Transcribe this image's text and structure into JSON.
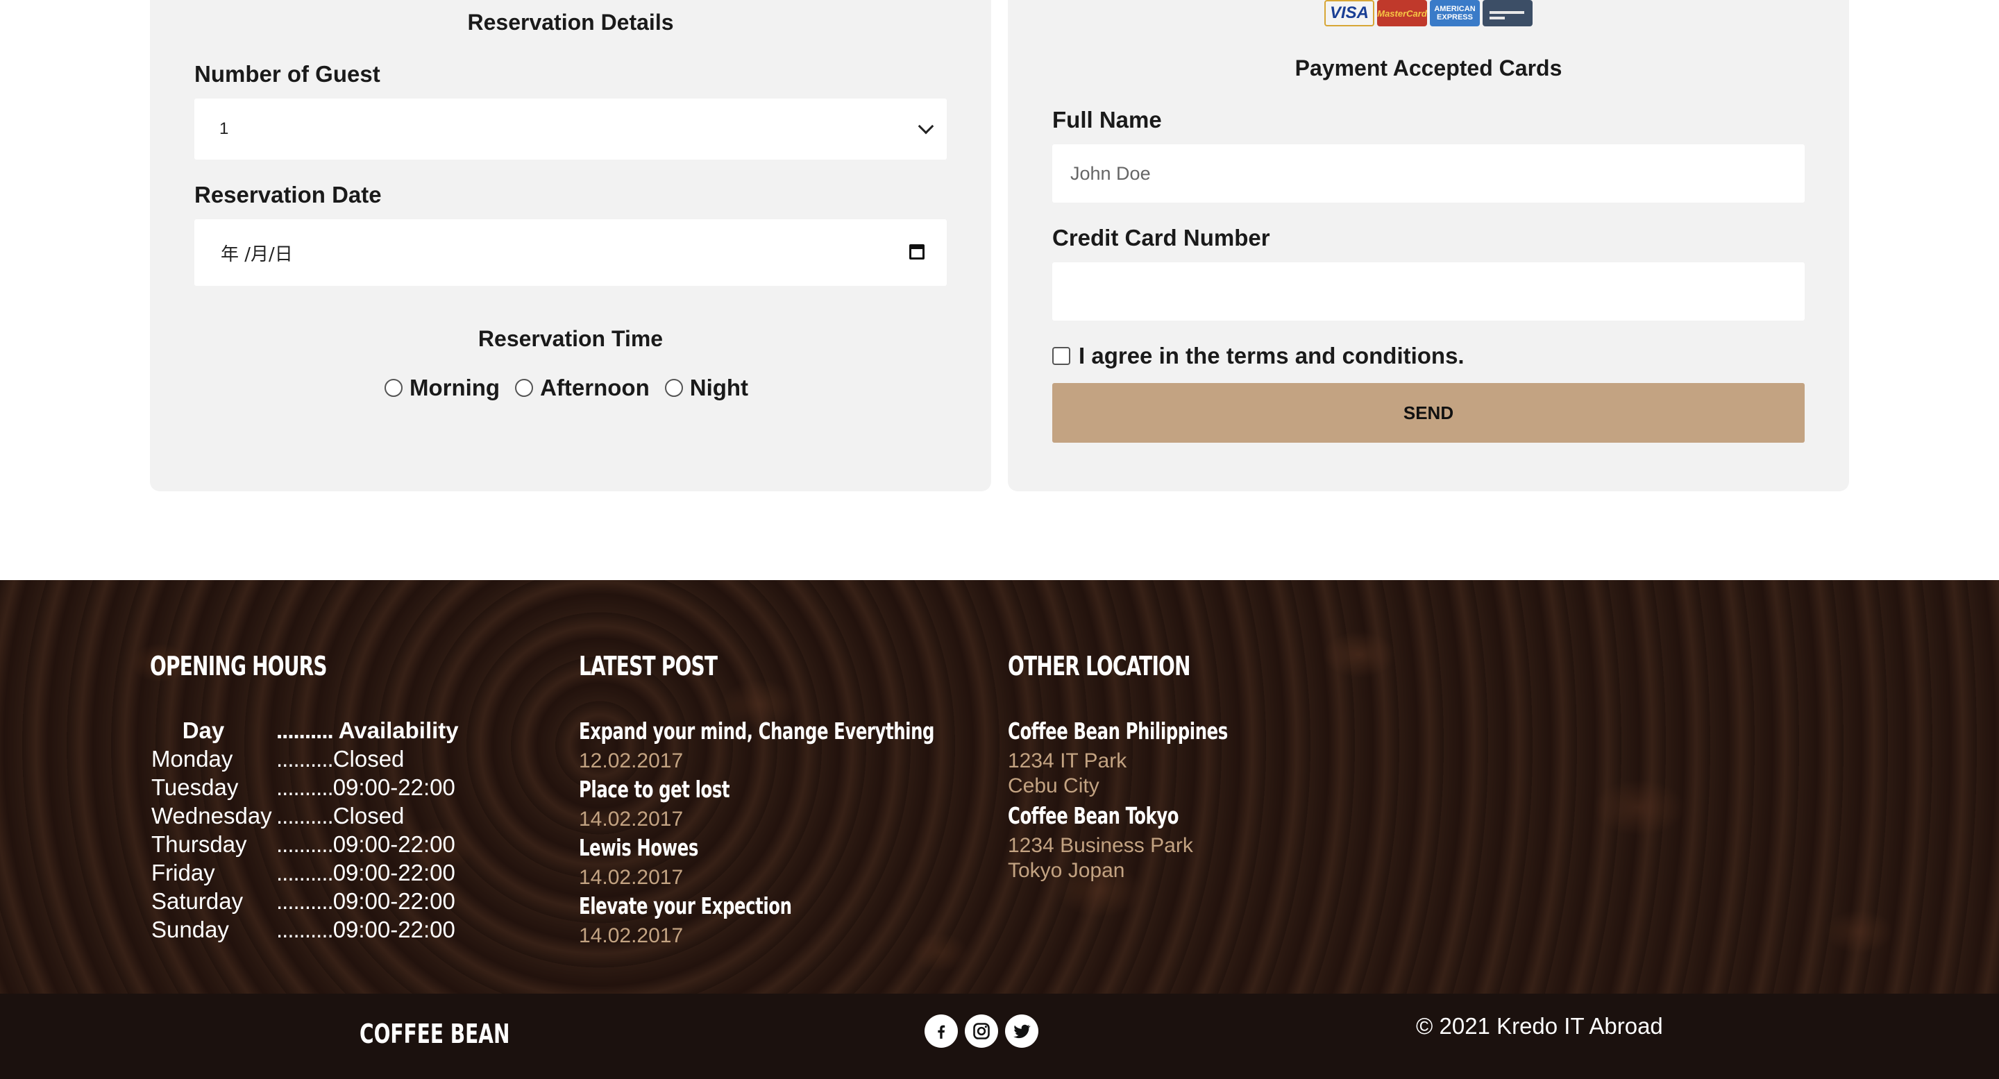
{
  "reservation": {
    "title": "Reservation Details",
    "guest_label": "Number of Guest",
    "guest_value": "1",
    "date_label": "Reservation Date",
    "date_placeholder": "年 /月/日",
    "time_label": "Reservation Time",
    "time_options": [
      "Morning",
      "Afternoon",
      "Night"
    ]
  },
  "payment": {
    "cards": [
      "VISA",
      "MasterCard",
      "AMERICAN EXPRESS"
    ],
    "title": "Payment Accepted Cards",
    "name_label": "Full Name",
    "name_placeholder": "John Doe",
    "card_label": "Credit Card Number",
    "card_value": "",
    "terms_label": "I agree in the terms and conditions.",
    "send_label": "SEND"
  },
  "footer": {
    "hours": {
      "heading": "OPENING HOURS",
      "col_day": "Day",
      "col_avail": "Availability",
      "dots": "..........",
      "rows": [
        {
          "day": "Monday",
          "time": "Closed"
        },
        {
          "day": "Tuesday",
          "time": "09:00-22:00"
        },
        {
          "day": "Wednesday",
          "time": "Closed"
        },
        {
          "day": "Thursday",
          "time": "09:00-22:00"
        },
        {
          "day": "Friday",
          "time": "09:00-22:00"
        },
        {
          "day": "Saturday",
          "time": "09:00-22:00"
        },
        {
          "day": "Sunday",
          "time": "09:00-22:00"
        }
      ]
    },
    "posts": {
      "heading": "LATEST POST",
      "items": [
        {
          "title": "Expand your mind, Change Everything",
          "date": "12.02.2017"
        },
        {
          "title": "Place to get lost",
          "date": "14.02.2017"
        },
        {
          "title": "Lewis Howes",
          "date": "14.02.2017"
        },
        {
          "title": "Elevate your Expection",
          "date": "14.02.2017"
        }
      ]
    },
    "locations": {
      "heading": "OTHER LOCATION",
      "items": [
        {
          "name": "Coffee Bean Philippines",
          "line1": "1234 IT Park",
          "line2": "Cebu City"
        },
        {
          "name": "Coffee Bean Tokyo",
          "line1": "1234 Business Park",
          "line2": "Tokyo Jopan"
        }
      ]
    },
    "bar": {
      "brand": "COFFEE BEAN",
      "social": [
        "facebook-icon",
        "instagram-icon",
        "twitter-icon"
      ],
      "copyright": "© 2021 Kredo IT Abroad"
    }
  }
}
